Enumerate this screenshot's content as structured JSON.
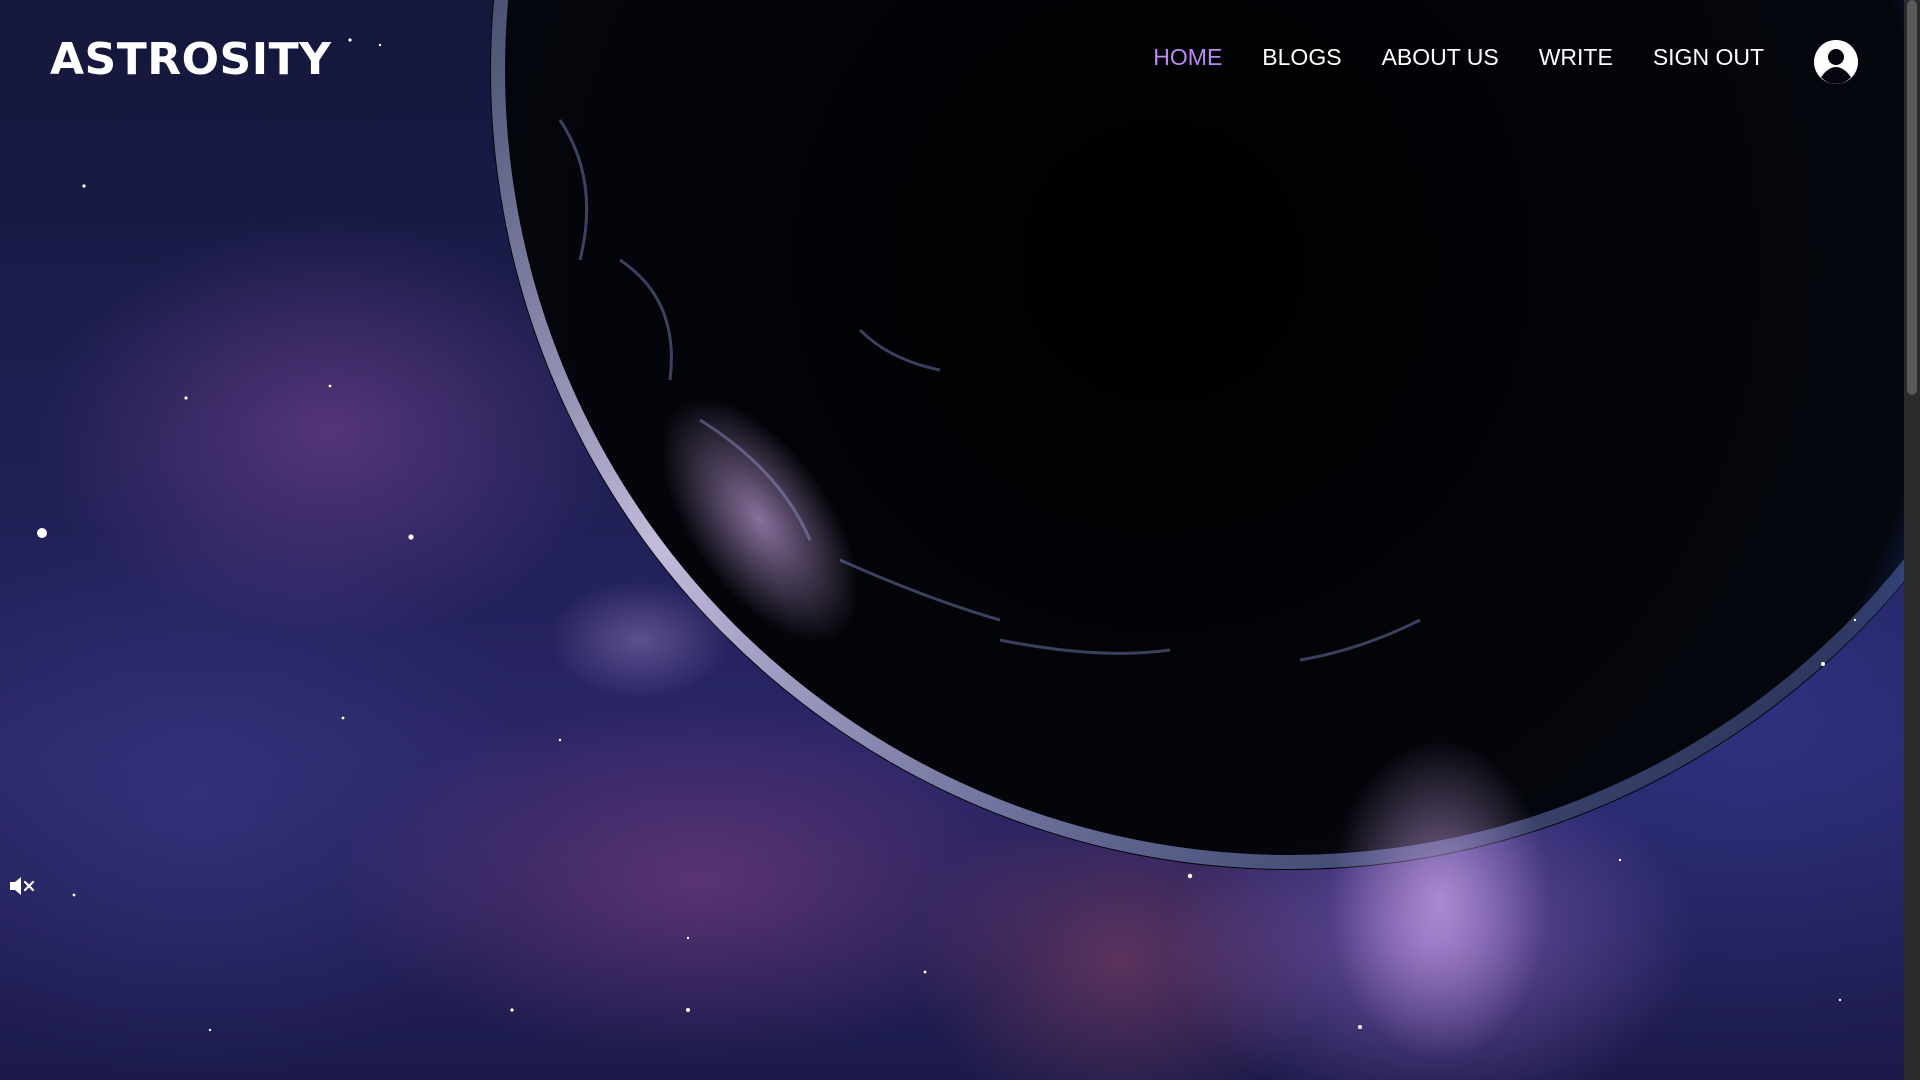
{
  "app": {
    "brand": "ASTROSITY"
  },
  "nav": {
    "items": [
      {
        "label": "HOME",
        "active": true
      },
      {
        "label": "BLOGS",
        "active": false
      },
      {
        "label": "ABOUT US",
        "active": false
      },
      {
        "label": "WRITE",
        "active": false
      },
      {
        "label": "SIGN OUT",
        "active": false
      }
    ],
    "active_color": "#b98af0",
    "profile_icon": "user-circle-icon"
  },
  "background": {
    "media": "space-planet-video",
    "mute_icon": "volume-mute-icon"
  }
}
